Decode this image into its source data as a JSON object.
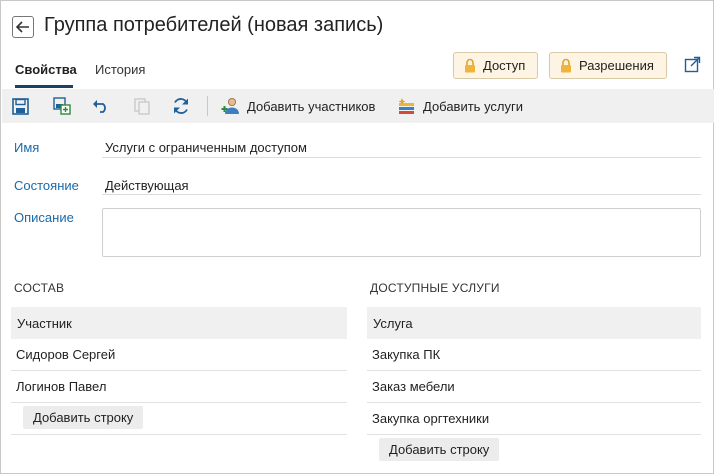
{
  "header": {
    "title": "Группа потребителей (новая запись)"
  },
  "tabs": [
    {
      "label": "Свойства"
    },
    {
      "label": "История"
    }
  ],
  "buttons": {
    "access": "Доступ",
    "permissions": "Разрешения"
  },
  "toolbar": {
    "add_participants": "Добавить участников",
    "add_services": "Добавить услуги"
  },
  "form": {
    "name_label": "Имя",
    "name_value": "Услуги с ограниченным доступом",
    "state_label": "Состояние",
    "state_value": "Действующая",
    "description_label": "Описание",
    "description_value": ""
  },
  "composition": {
    "title": "СОСТАВ",
    "column": "Участник",
    "rows": [
      "Сидоров Сергей",
      "Логинов Павел"
    ],
    "add_row": "Добавить строку"
  },
  "services": {
    "title": "ДОСТУПНЫЕ УСЛУГИ",
    "column": "Услуга",
    "rows": [
      "Закупка ПК",
      "Заказ мебели",
      "Закупка оргтехники"
    ],
    "add_row": "Добавить строку"
  },
  "colors": {
    "accent": "#1f3f63",
    "link": "#1a6aa8",
    "perm_bg": "#fdf4e3",
    "toolbar_bg": "#f0f0f0"
  }
}
